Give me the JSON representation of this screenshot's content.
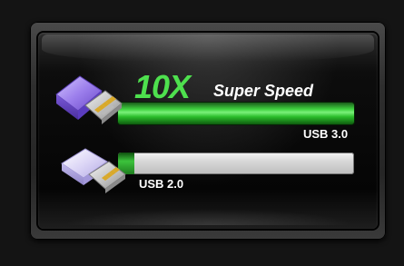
{
  "headline": {
    "multiplier": "10X",
    "text": "Super Speed"
  },
  "bars": [
    {
      "id": "usb3",
      "label": "USB 3.0",
      "fill_fraction": 1.0,
      "color": "#3ed13e"
    },
    {
      "id": "usb2",
      "label": "USB 2.0",
      "fill_fraction": 0.07,
      "color": "#3cc33c"
    }
  ],
  "icons": {
    "usb3_drive": "usb-drive-purple-icon",
    "usb2_drive": "usb-drive-lavender-icon"
  },
  "colors": {
    "accent_green": "#4ee04e",
    "usb3_drive": "#8b6fe0",
    "usb2_drive": "#c9c2ef",
    "background": "#141414"
  }
}
